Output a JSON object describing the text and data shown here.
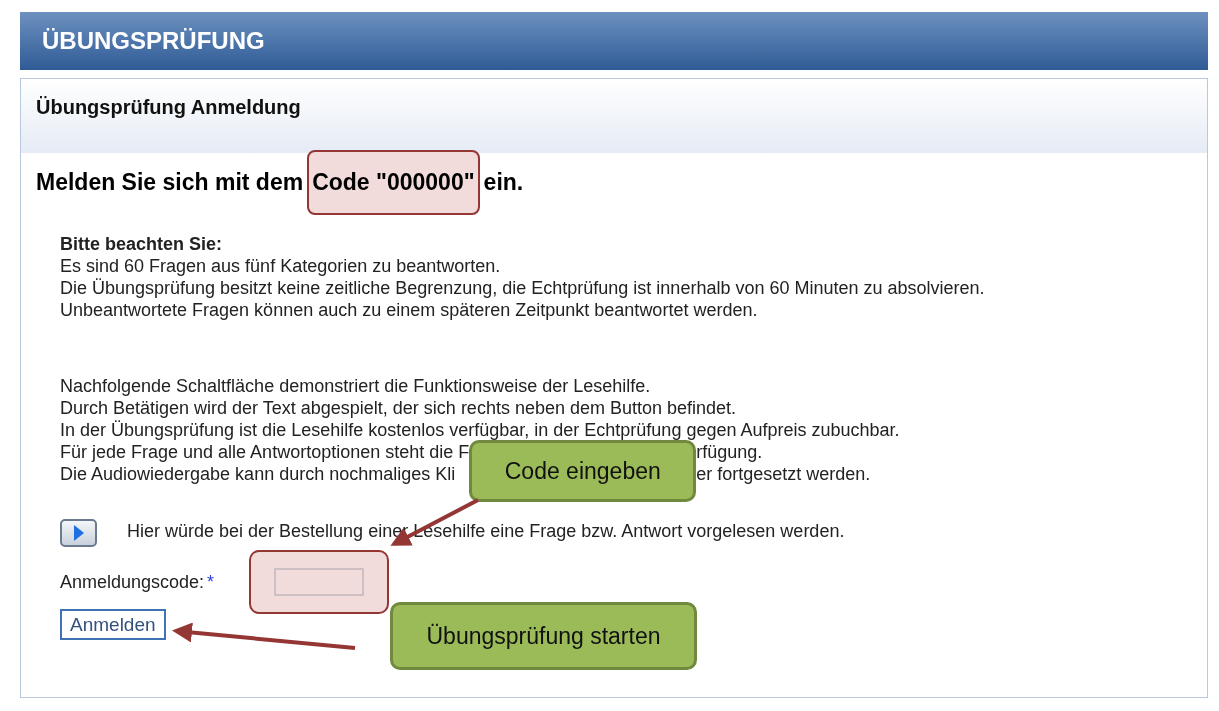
{
  "header": {
    "title": "ÜBUNGSPRÜFUNG"
  },
  "panel": {
    "title": "Übungsprüfung Anmeldung"
  },
  "heading": {
    "before": "Melden Sie sich mit dem",
    "highlighted": "Code \"000000\"",
    "after": "ein."
  },
  "notice": {
    "title": "Bitte beachten Sie:",
    "lines": [
      "Es sind 60 Fragen aus fünf Kategorien zu beantworten.",
      "Die Übungsprüfung besitzt keine zeitliche Begrenzung, die Echtprüfung ist innerhalb von 60 Minuten zu absolvieren.",
      "Unbeantwortete Fragen können auch zu einem späteren Zeitpunkt beantwortet werden."
    ]
  },
  "reading_aid": {
    "lines": [
      "Nachfolgende Schaltfläche demonstriert die Funktionsweise der Lesehilfe.",
      "Durch Betätigen wird der Text abgespielt, der sich rechts neben dem Button befindet.",
      "In der Übungsprüfung ist die Lesehilfe kostenlos verfügbar, in der Echtprüfung gegen Aufpreis zubuchbar."
    ],
    "covered_lines": [
      {
        "before": "Für jede Frage und alle Antwortoptionen steht die F",
        "after": "rfügung."
      },
      {
        "before": "Die Audiowiedergabe kann durch nochmaliges Kli",
        "after": "er fortgesetzt werden."
      }
    ],
    "callout": "Code eingeben"
  },
  "player": {
    "text": "Hier würde bei der Bestellung einer Lesehilfe eine Frage bzw. Antwort vorgelesen werden."
  },
  "form": {
    "label": "Anmeldungscode:",
    "required_mark": "*",
    "button": "Anmelden",
    "callout": "Übungsprüfung starten"
  }
}
